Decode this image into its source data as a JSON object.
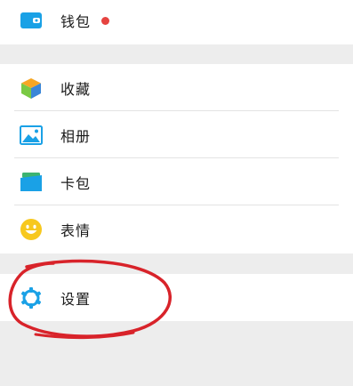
{
  "menu": {
    "wallet": {
      "label": "钱包",
      "icon": "wallet-icon",
      "has_badge": true
    },
    "favorites": {
      "label": "收藏",
      "icon": "favorites-cube-icon"
    },
    "album": {
      "label": "相册",
      "icon": "photo-album-icon"
    },
    "cards": {
      "label": "卡包",
      "icon": "card-wallet-icon"
    },
    "stickers": {
      "label": "表情",
      "icon": "smiley-face-icon"
    },
    "settings": {
      "label": "设置",
      "icon": "gear-icon"
    }
  },
  "colors": {
    "accent_blue": "#1aa1e6",
    "badge_red": "#e64340",
    "annotation_red": "#d8232a",
    "cube_orange": "#f6a623",
    "cube_green": "#7ac943",
    "cube_blue": "#3a86d8",
    "card_green": "#3cb371",
    "smiley_yellow": "#f7c81e"
  }
}
